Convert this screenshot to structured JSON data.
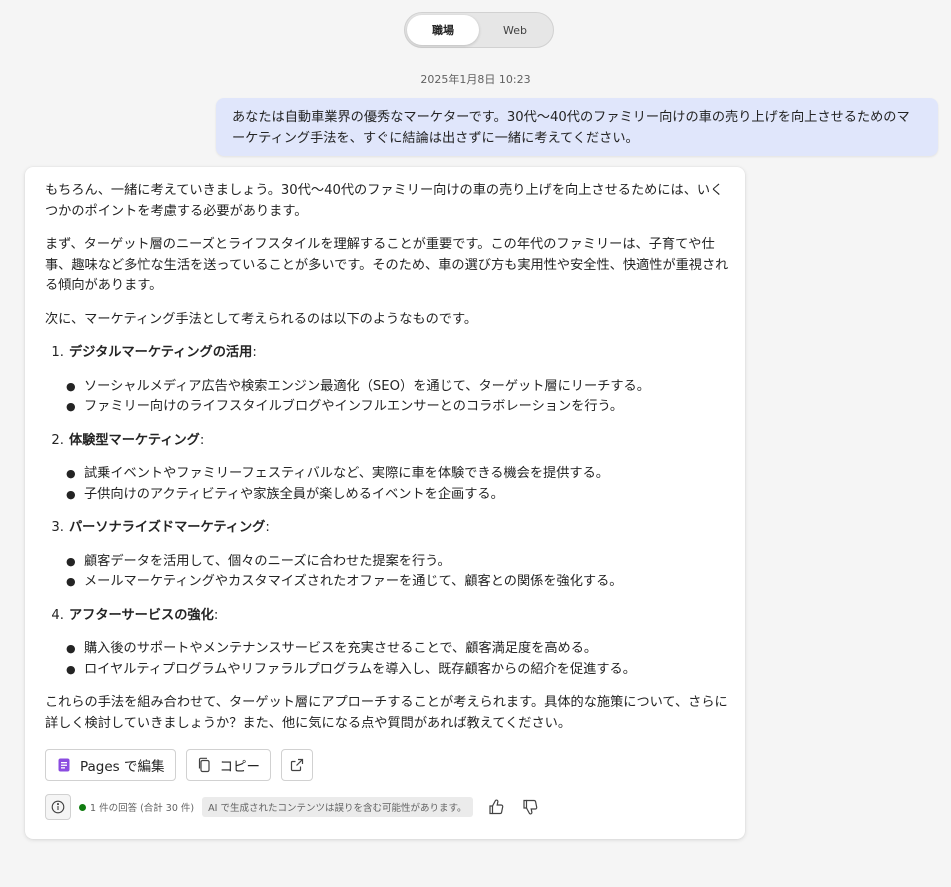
{
  "toggle": {
    "work": "職場",
    "web": "Web"
  },
  "timestamp": "2025年1月8日 10:23",
  "user_message": "あなたは自動車業界の優秀なマーケターです。30代〜40代のファミリー向けの車の売り上げを向上させるためのマーケティング手法を、すぐに結論は出さずに一緒に考えてください。",
  "response": {
    "intro": "もちろん、一緒に考えていきましょう。30代〜40代のファミリー向けの車の売り上げを向上させるためには、いくつかのポイントを考慮する必要があります。",
    "para2": "まず、ターゲット層のニーズとライフスタイルを理解することが重要です。この年代のファミリーは、子育てや仕事、趣味など多忙な生活を送っていることが多いです。そのため、車の選び方も実用性や安全性、快適性が重視される傾向があります。",
    "para3": "次に、マーケティング手法として考えられるのは以下のようなものです。",
    "items": [
      {
        "num": "1.",
        "title": "デジタルマーケティングの活用",
        "colon": ":",
        "bullets": [
          "ソーシャルメディア広告や検索エンジン最適化（SEO）を通じて、ターゲット層にリーチする。",
          "ファミリー向けのライフスタイルブログやインフルエンサーとのコラボレーションを行う。"
        ]
      },
      {
        "num": "2.",
        "title": "体験型マーケティング",
        "colon": ":",
        "bullets": [
          "試乗イベントやファミリーフェスティバルなど、実際に車を体験できる機会を提供する。",
          "子供向けのアクティビティや家族全員が楽しめるイベントを企画する。"
        ]
      },
      {
        "num": "3.",
        "title": "パーソナライズドマーケティング",
        "colon": ":",
        "bullets": [
          "顧客データを活用して、個々のニーズに合わせた提案を行う。",
          "メールマーケティングやカスタマイズされたオファーを通じて、顧客との関係を強化する。"
        ]
      },
      {
        "num": "4.",
        "title": "アフターサービスの強化",
        "colon": ":",
        "bullets": [
          "購入後のサポートやメンテナンスサービスを充実させることで、顧客満足度を高める。",
          "ロイヤルティプログラムやリファラルプログラムを導入し、既存顧客からの紹介を促進する。"
        ]
      }
    ],
    "outro": "これらの手法を組み合わせて、ターゲット層にアプローチすることが考えられます。具体的な施策について、さらに詳しく検討していきましょうか？また、他に気になる点や質問があれば教えてください。"
  },
  "actions": {
    "pages_label": "Pages で編集",
    "copy_label": "コピー"
  },
  "footer": {
    "response_count": "1 件の回答 (合計 30 件)",
    "disclaimer": "AI で生成されたコンテンツは誤りを含む可能性があります。"
  },
  "colors": {
    "accent": "#7b3fd1",
    "status_green": "#107c10",
    "user_bubble": "#e0e6fb"
  }
}
